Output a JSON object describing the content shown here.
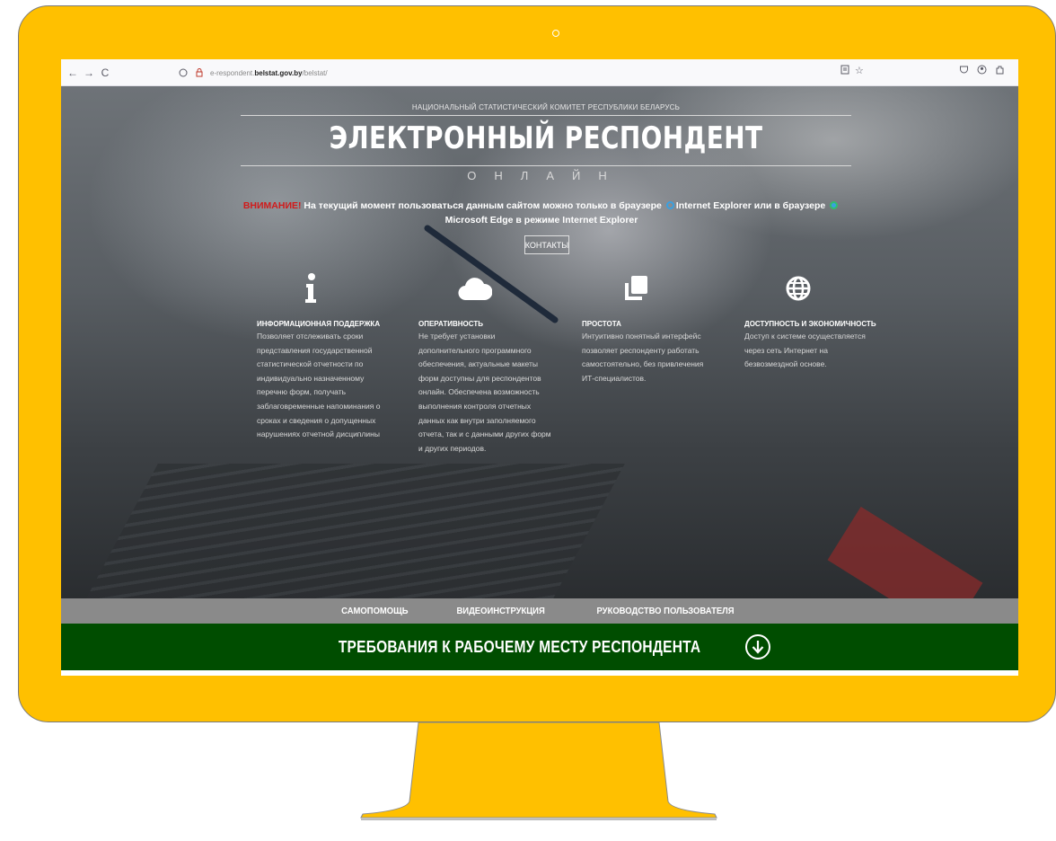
{
  "browser": {
    "url_prefix": "e-respondent.",
    "url_host": "belstat.gov.by",
    "url_path": "/belstat/",
    "nav": {
      "back": "←",
      "forward": "→",
      "reload": "C"
    }
  },
  "header": {
    "agency": "НАЦИОНАЛЬНЫЙ СТАТИСТИЧЕСКИЙ КОМИТЕТ РЕСПУБЛИКИ БЕЛАРУСЬ",
    "title": "ЭЛЕКТРОННЫЙ РЕСПОНДЕНТ",
    "subtitle": "ОНЛАЙН"
  },
  "notice": {
    "warning": "ВНИМАНИЕ!",
    "text_1": " На текущий момент пользоваться данным сайтом можно только в браузере ",
    "ie": "Internet Explorer",
    "text_2": " или в браузере ",
    "edge": "Microsoft Edge",
    "text_3": " в режиме Internet Explorer"
  },
  "contacts_label": "КОНТАКТЫ",
  "features": [
    {
      "icon": "info-icon",
      "title": "ИНФОРМАЦИОННАЯ ПОДДЕРЖКА",
      "text": "Позволяет отслеживать сроки представления государственной статистической отчетности по индивидуально назначенному перечню форм, получать заблаговременные напоминания о сроках и сведения о допущенных нарушениях отчетной дисциплины"
    },
    {
      "icon": "cloud-icon",
      "title": "ОПЕРАТИВНОСТЬ",
      "text": "Не требует установки дополнительного программного обеспечения, актуальные макеты форм доступны для респондентов онлайн. Обеспечена возможность выполнения контроля отчетных данных как внутри заполняемого отчета, так и с данными других форм и других периодов."
    },
    {
      "icon": "copy-icon",
      "title": "ПРОСТОТА",
      "text": "Интуитивно понятный интерфейс позволяет респонденту работать самостоятельно, без привлечения ИТ-специалистов."
    },
    {
      "icon": "globe-icon",
      "title": "ДОСТУПНОСТЬ И ЭКОНОМИЧНОСТЬ",
      "text": "Доступ к системе осуществляется через сеть Интернет на безвозмездной основе."
    }
  ],
  "menu": {
    "self_help": "САМОПОМОЩЬ",
    "video": "ВИДЕОИНСТРУКЦИЯ",
    "manual": "РУКОВОДСТВО ПОЛЬЗОВАТЕЛЯ"
  },
  "requirements": "ТРЕБОВАНИЯ К РАБОЧЕМУ МЕСТУ РЕСПОНДЕНТА",
  "colors": {
    "monitor": "#ffc000",
    "warning": "#d11b1b",
    "requirements_bg": "#004d00",
    "menu_bg": "#8a8a8a"
  }
}
